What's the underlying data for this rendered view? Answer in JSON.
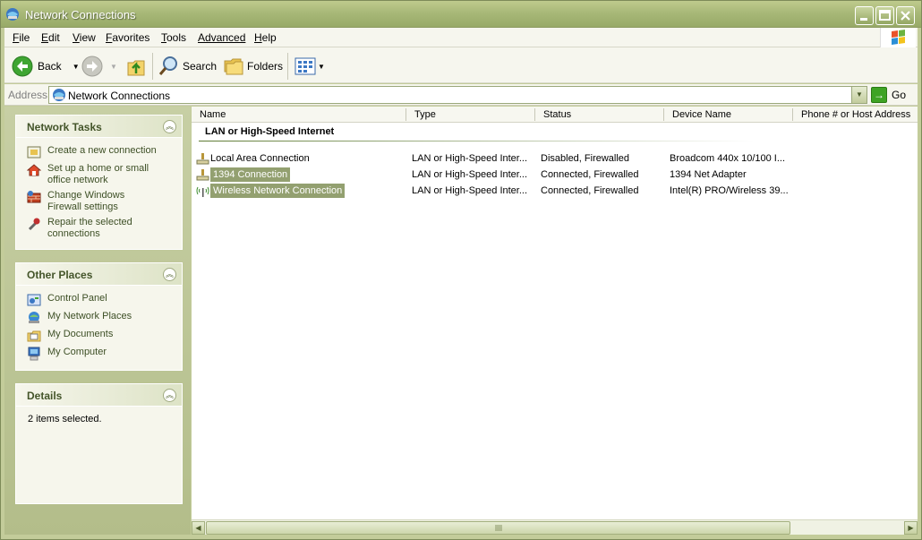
{
  "window": {
    "title": "Network Connections"
  },
  "menu": {
    "items": [
      {
        "label": "File",
        "u": "F",
        "rest": "ile"
      },
      {
        "label": "Edit",
        "u": "E",
        "rest": "dit"
      },
      {
        "label": "View",
        "u": "V",
        "rest": "iew"
      },
      {
        "label": "Favorites",
        "u": "F",
        "rest": "avorites",
        "pre": ""
      },
      {
        "label": "Tools",
        "u": "T",
        "rest": "ools"
      },
      {
        "label": "Advanced",
        "u": "",
        "rest": "Advanced"
      },
      {
        "label": "Help",
        "u": "H",
        "rest": "elp"
      }
    ]
  },
  "toolbar": {
    "back_label": "Back",
    "search_label": "Search",
    "folders_label": "Folders"
  },
  "address": {
    "label": "Address",
    "value": "Network Connections",
    "go_label": "Go"
  },
  "sidebar": {
    "network_tasks": {
      "title": "Network Tasks",
      "items": [
        {
          "label": "Create a new connection",
          "icon": "new-connection-icon"
        },
        {
          "label": "Set up a home or small office network",
          "icon": "home-network-icon"
        },
        {
          "label": "Change Windows Firewall settings",
          "icon": "firewall-icon"
        },
        {
          "label": "Repair the selected connections",
          "icon": "repair-icon"
        }
      ]
    },
    "other_places": {
      "title": "Other Places",
      "items": [
        {
          "label": "Control Panel",
          "icon": "control-panel-icon"
        },
        {
          "label": "My Network Places",
          "icon": "network-places-icon"
        },
        {
          "label": "My Documents",
          "icon": "documents-icon"
        },
        {
          "label": "My Computer",
          "icon": "computer-icon"
        }
      ]
    },
    "details": {
      "title": "Details",
      "text": "2 items selected."
    }
  },
  "content": {
    "columns": [
      "Name",
      "Type",
      "Status",
      "Device Name",
      "Phone # or Host Address"
    ],
    "group_title": "LAN or High-Speed Internet",
    "rows": [
      {
        "name": "Local Area Connection",
        "type": "LAN or High-Speed Inter...",
        "status": "Disabled, Firewalled",
        "device": "Broadcom 440x 10/100 I...",
        "selected": false
      },
      {
        "name": "1394 Connection",
        "type": "LAN or High-Speed Inter...",
        "status": "Connected, Firewalled",
        "device": "1394 Net Adapter",
        "selected": true
      },
      {
        "name": "Wireless Network Connection",
        "type": "LAN or High-Speed Inter...",
        "status": "Connected, Firewalled",
        "device": "Intel(R) PRO/Wireless 39...",
        "selected": true
      }
    ]
  },
  "colors": {
    "accent": "#93a070",
    "title_bar": "#a8b878",
    "link": "#3d4f25"
  }
}
